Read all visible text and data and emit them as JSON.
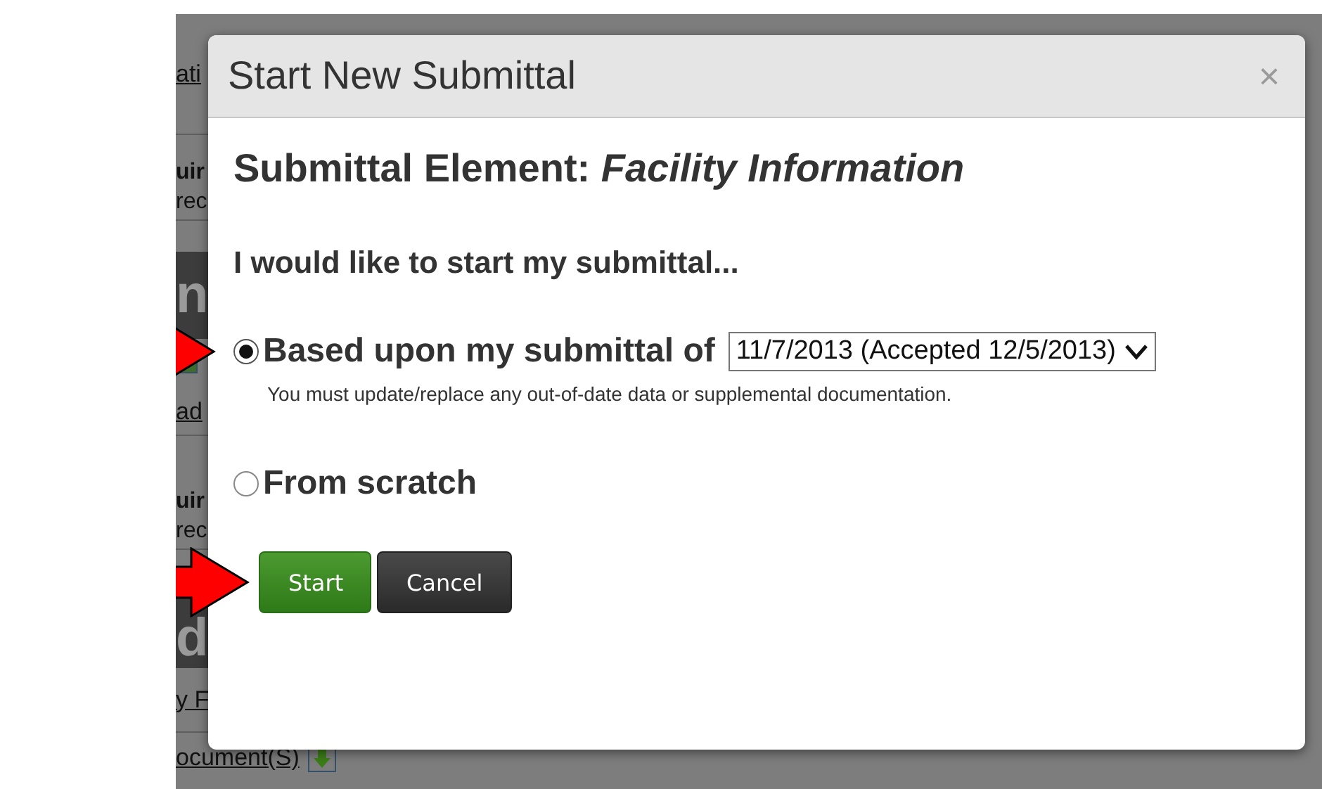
{
  "background": {
    "fragments": [
      {
        "kind": "link",
        "text": "ati"
      },
      {
        "kind": "bold",
        "text": "uir"
      },
      {
        "kind": "plain",
        "text": "rec"
      },
      {
        "kind": "band",
        "text": "n"
      },
      {
        "kind": "icon"
      },
      {
        "kind": "link",
        "text": "ad"
      },
      {
        "kind": "bold",
        "text": "uir"
      },
      {
        "kind": "plain",
        "text": "rec"
      },
      {
        "kind": "band",
        "text": "d"
      },
      {
        "kind": "link",
        "text": "y F"
      },
      {
        "kind": "download",
        "text": "ocument(S)"
      }
    ]
  },
  "dialog": {
    "title": "Start New Submittal",
    "close": "×",
    "heading": "Submittal Element: *Facility Information*",
    "prompt": "I would like to start my submittal...",
    "options": [
      {
        "label": "Based upon my submittal of",
        "selected": true,
        "arrow": true,
        "select_value": "11/7/2013 (Accepted 12/5/2013)",
        "note": "You must update/replace any out-of-date data or supplemental documentation."
      },
      {
        "label": "From scratch",
        "selected": false,
        "arrow": false
      }
    ],
    "buttons": [
      {
        "label": "Start",
        "kind": "primary",
        "arrow": true
      },
      {
        "label": "Cancel",
        "kind": "dark",
        "arrow": false
      }
    ]
  }
}
